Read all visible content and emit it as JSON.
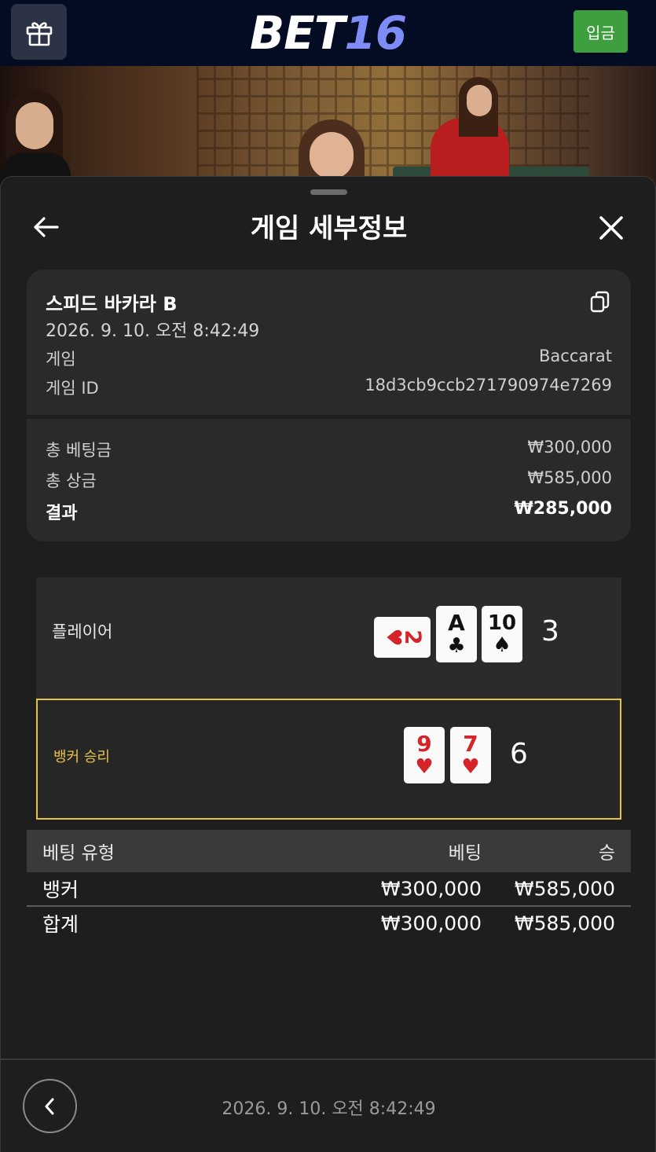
{
  "topbar": {
    "gift_icon": "gift-icon",
    "logo_part1": "BET",
    "logo_part2": "16",
    "deposit_label": "입금",
    "deposit_color": "#3e9f3e"
  },
  "sheet": {
    "title": "게임 세부정보",
    "back_icon": "arrow-left-icon",
    "close_icon": "close-icon"
  },
  "game_info": {
    "name": "스피드 바카라 B",
    "datetime": "2026. 9. 10. 오전 8:42:49",
    "game_label": "게임",
    "game_value": "Baccarat",
    "id_label": "게임 ID",
    "id_value": "18d3cb9ccb271790974e7269",
    "copy_icon": "copy-icon"
  },
  "summary": {
    "total_bet_label": "총 베팅금",
    "total_bet_value": "₩300,000",
    "total_win_label": "총 상금",
    "total_win_value": "₩585,000",
    "result_label": "결과",
    "result_value": "₩285,000"
  },
  "hands": {
    "player": {
      "label": "플레이어",
      "cards": [
        {
          "rank": "2",
          "suit": "♥",
          "color": "red",
          "orientation": "sideways"
        },
        {
          "rank": "A",
          "suit": "♣",
          "color": "black"
        },
        {
          "rank": "10",
          "suit": "♠",
          "color": "black"
        }
      ],
      "score": "3"
    },
    "banker": {
      "label": "뱅커 승리",
      "cards": [
        {
          "rank": "9",
          "suit": "♥",
          "color": "red"
        },
        {
          "rank": "7",
          "suit": "♥",
          "color": "red"
        }
      ],
      "score": "6",
      "highlight_color": "#e7c24a"
    }
  },
  "bet_table": {
    "headers": [
      "베팅 유형",
      "베팅",
      "승"
    ],
    "rows": [
      [
        "뱅커",
        "₩300,000",
        "₩585,000"
      ]
    ],
    "total": [
      "합계",
      "₩300,000",
      "₩585,000"
    ]
  },
  "footer": {
    "prev_icon": "chevron-left-icon",
    "datetime": "2026. 9. 10. 오전 8:42:49"
  }
}
